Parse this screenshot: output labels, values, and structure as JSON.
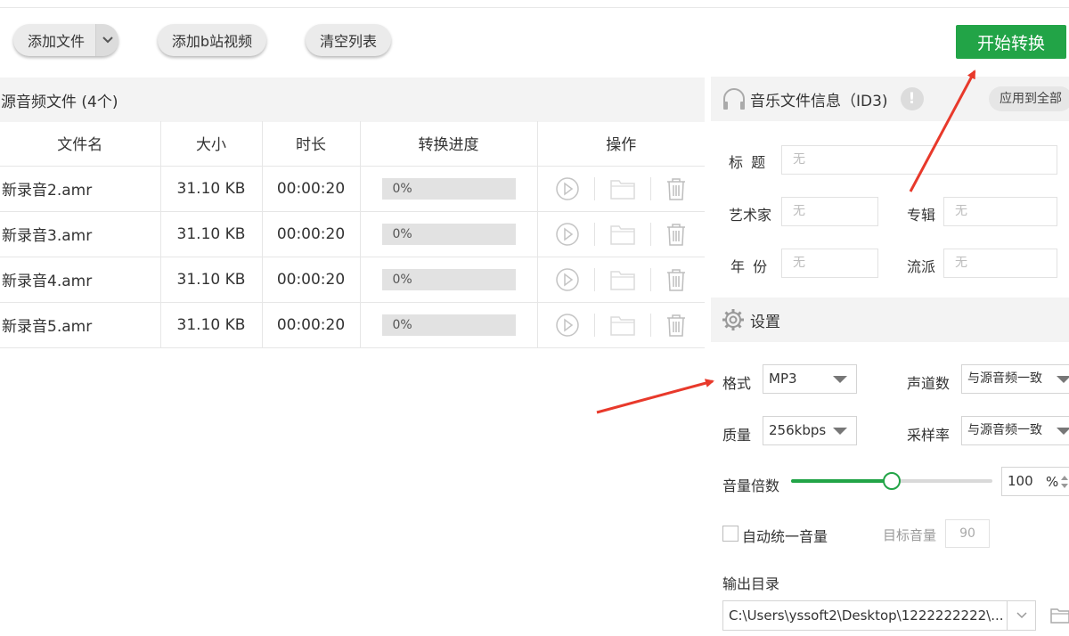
{
  "toolbar": {
    "add_file": "添加文件",
    "add_bili": "添加b站视频",
    "clear_list": "清空列表",
    "start": "开始转换"
  },
  "file_panel": {
    "title": "源音频文件 (4个)",
    "columns": [
      "文件名",
      "大小",
      "时长",
      "转换进度",
      "操作"
    ],
    "rows": [
      {
        "name": "新录音2.amr",
        "size": "31.10 KB",
        "duration": "00:00:20",
        "progress": "0%"
      },
      {
        "name": "新录音3.amr",
        "size": "31.10 KB",
        "duration": "00:00:20",
        "progress": "0%"
      },
      {
        "name": "新录音4.amr",
        "size": "31.10 KB",
        "duration": "00:00:20",
        "progress": "0%"
      },
      {
        "name": "新录音5.amr",
        "size": "31.10 KB",
        "duration": "00:00:20",
        "progress": "0%"
      }
    ]
  },
  "id3": {
    "title": "音乐文件信息（ID3)",
    "apply_all": "应用到全部",
    "fields": {
      "title_label": "标  题",
      "artist_label": "艺术家",
      "album_label": "专辑",
      "year_label": "年  份",
      "genre_label": "流派",
      "placeholder": "无"
    }
  },
  "settings": {
    "title": "设置",
    "format_label": "格式",
    "format_value": "MP3",
    "channel_label": "声道数",
    "channel_value": "与源音频一致",
    "quality_label": "质量",
    "quality_value": "256kbps",
    "samplerate_label": "采样率",
    "samplerate_value": "与源音频一致",
    "volume_label": "音量倍数",
    "volume_value": "100",
    "volume_unit": "%",
    "volume_fraction": 0.5,
    "auto_volume_label": "自动统一音量",
    "target_volume_label": "目标音量",
    "target_volume_value": "90",
    "output_label": "输出目录",
    "output_path": "C:\\Users\\yssoft2\\Desktop\\1222222222\\..."
  },
  "colors": {
    "accent": "#22a447",
    "annotation_arrow": "#e8392b"
  }
}
